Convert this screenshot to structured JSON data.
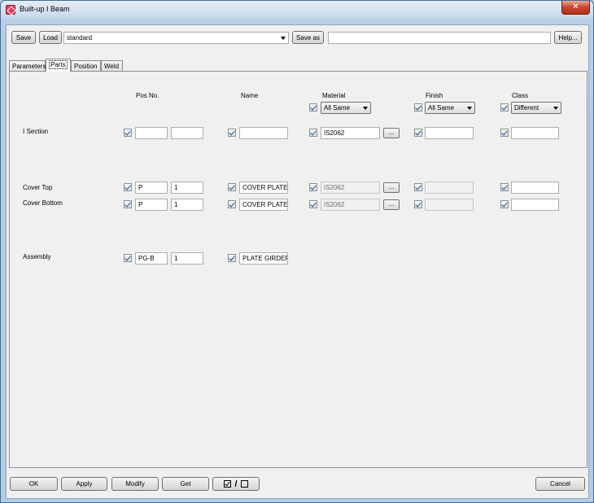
{
  "window": {
    "title": "Built-up I Beam",
    "close_label": "✕"
  },
  "toolbar": {
    "save_label": "Save",
    "load_label": "Load",
    "preset_value": "standard",
    "save_as_label": "Save as",
    "save_as_name": "",
    "help_label": "Help..."
  },
  "tabs": [
    {
      "label": "Parameters"
    },
    {
      "label": "Parts"
    },
    {
      "label": "Position"
    },
    {
      "label": "Weld"
    }
  ],
  "columns": {
    "pos_no": "Pos No.",
    "name": "Name",
    "material": "Material",
    "finish": "Finish",
    "class": "Class"
  },
  "header_combos": {
    "material": "All Same",
    "finish": "All Same",
    "class": "Different"
  },
  "rows": [
    {
      "label": "I Section",
      "prefix": "",
      "start": "",
      "name": "",
      "material": "IS2062",
      "finish": "",
      "class": ""
    },
    {
      "label": "Cover Top",
      "prefix": "P",
      "start": "1",
      "name": "COVER PLATE",
      "material": "IS2062",
      "finish": "",
      "class": ""
    },
    {
      "label": "Cover Bottom",
      "prefix": "P",
      "start": "1",
      "name": "COVER PLATE",
      "material": "IS2062",
      "finish": "",
      "class": ""
    },
    {
      "label": "Assembly",
      "prefix": "PG-B",
      "start": "1",
      "name": "PLATE GIRDEF"
    }
  ],
  "browse_label": "...",
  "bottom": {
    "ok": "OK",
    "apply": "Apply",
    "modify": "Modify",
    "get": "Get",
    "toggle_separator": "/",
    "cancel": "Cancel"
  }
}
